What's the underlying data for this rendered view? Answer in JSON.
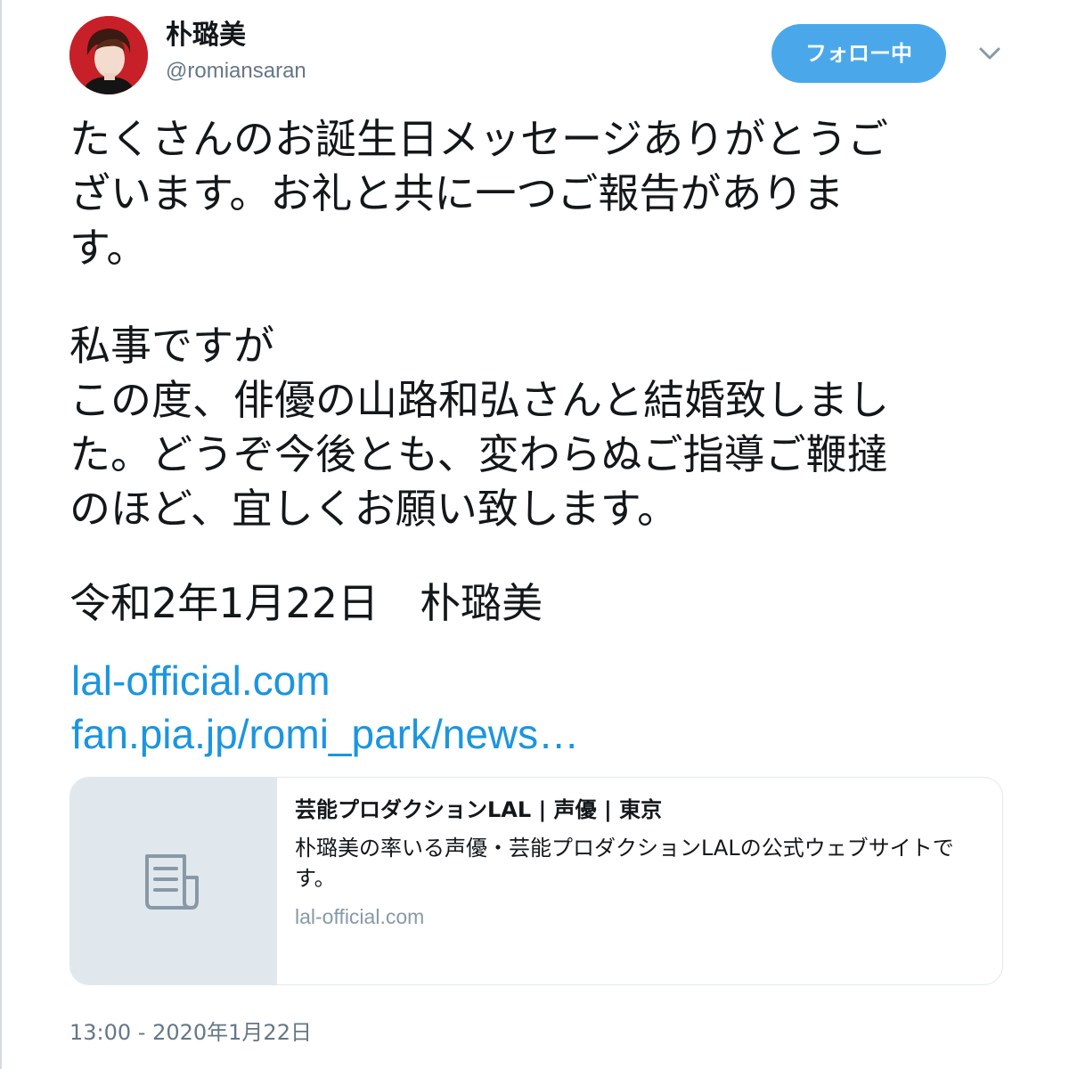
{
  "user": {
    "display_name": "朴璐美",
    "handle": "@romiansaran",
    "avatar": "avatar-photo"
  },
  "header": {
    "follow_label": "フォロー中",
    "menu_icon": "chevron-down-icon"
  },
  "tweet": {
    "lines": [
      "たくさんのお誕生日メッセージありがとうご",
      "ざいます。お礼と共に一つご報告がありま",
      "す。",
      "私事ですが",
      "この度、俳優の山路和弘さんと結婚致しまし",
      "た。どうぞ今後とも、変わらぬご指導ご鞭撻",
      "のほど、宜しくお願い致します。",
      "令和2年1月22日　朴璐美"
    ],
    "links": [
      "lal-official.com",
      "fan.pia.jp/romi_park/news…"
    ]
  },
  "card": {
    "icon": "document-icon",
    "title": "芸能プロダクションLAL | 声優 | 東京",
    "description": "朴璐美の率いる声優・芸能プロダクションLALの公式ウェブサイトです。",
    "domain": "lal-official.com"
  },
  "timestamp": "13:00 - 2020年1月22日",
  "colors": {
    "accent": "#4aa8ea",
    "link": "#1b95e0",
    "secondary_text": "#657786",
    "card_border": "#e1e8ed"
  }
}
